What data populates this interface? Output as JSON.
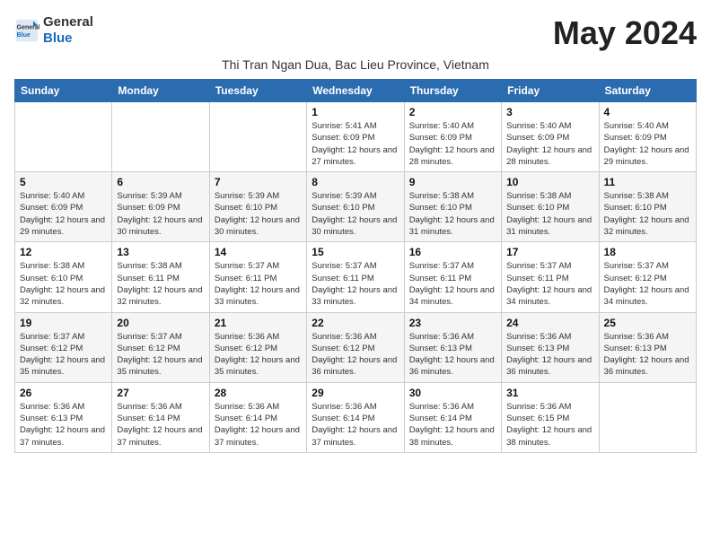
{
  "header": {
    "logo_general": "General",
    "logo_blue": "Blue",
    "month_title": "May 2024",
    "subtitle": "Thi Tran Ngan Dua, Bac Lieu Province, Vietnam"
  },
  "weekdays": [
    "Sunday",
    "Monday",
    "Tuesday",
    "Wednesday",
    "Thursday",
    "Friday",
    "Saturday"
  ],
  "weeks": [
    [
      {
        "day": "",
        "info": ""
      },
      {
        "day": "",
        "info": ""
      },
      {
        "day": "",
        "info": ""
      },
      {
        "day": "1",
        "info": "Sunrise: 5:41 AM\nSunset: 6:09 PM\nDaylight: 12 hours and 27 minutes."
      },
      {
        "day": "2",
        "info": "Sunrise: 5:40 AM\nSunset: 6:09 PM\nDaylight: 12 hours and 28 minutes."
      },
      {
        "day": "3",
        "info": "Sunrise: 5:40 AM\nSunset: 6:09 PM\nDaylight: 12 hours and 28 minutes."
      },
      {
        "day": "4",
        "info": "Sunrise: 5:40 AM\nSunset: 6:09 PM\nDaylight: 12 hours and 29 minutes."
      }
    ],
    [
      {
        "day": "5",
        "info": "Sunrise: 5:40 AM\nSunset: 6:09 PM\nDaylight: 12 hours and 29 minutes."
      },
      {
        "day": "6",
        "info": "Sunrise: 5:39 AM\nSunset: 6:09 PM\nDaylight: 12 hours and 30 minutes."
      },
      {
        "day": "7",
        "info": "Sunrise: 5:39 AM\nSunset: 6:10 PM\nDaylight: 12 hours and 30 minutes."
      },
      {
        "day": "8",
        "info": "Sunrise: 5:39 AM\nSunset: 6:10 PM\nDaylight: 12 hours and 30 minutes."
      },
      {
        "day": "9",
        "info": "Sunrise: 5:38 AM\nSunset: 6:10 PM\nDaylight: 12 hours and 31 minutes."
      },
      {
        "day": "10",
        "info": "Sunrise: 5:38 AM\nSunset: 6:10 PM\nDaylight: 12 hours and 31 minutes."
      },
      {
        "day": "11",
        "info": "Sunrise: 5:38 AM\nSunset: 6:10 PM\nDaylight: 12 hours and 32 minutes."
      }
    ],
    [
      {
        "day": "12",
        "info": "Sunrise: 5:38 AM\nSunset: 6:10 PM\nDaylight: 12 hours and 32 minutes."
      },
      {
        "day": "13",
        "info": "Sunrise: 5:38 AM\nSunset: 6:11 PM\nDaylight: 12 hours and 32 minutes."
      },
      {
        "day": "14",
        "info": "Sunrise: 5:37 AM\nSunset: 6:11 PM\nDaylight: 12 hours and 33 minutes."
      },
      {
        "day": "15",
        "info": "Sunrise: 5:37 AM\nSunset: 6:11 PM\nDaylight: 12 hours and 33 minutes."
      },
      {
        "day": "16",
        "info": "Sunrise: 5:37 AM\nSunset: 6:11 PM\nDaylight: 12 hours and 34 minutes."
      },
      {
        "day": "17",
        "info": "Sunrise: 5:37 AM\nSunset: 6:11 PM\nDaylight: 12 hours and 34 minutes."
      },
      {
        "day": "18",
        "info": "Sunrise: 5:37 AM\nSunset: 6:12 PM\nDaylight: 12 hours and 34 minutes."
      }
    ],
    [
      {
        "day": "19",
        "info": "Sunrise: 5:37 AM\nSunset: 6:12 PM\nDaylight: 12 hours and 35 minutes."
      },
      {
        "day": "20",
        "info": "Sunrise: 5:37 AM\nSunset: 6:12 PM\nDaylight: 12 hours and 35 minutes."
      },
      {
        "day": "21",
        "info": "Sunrise: 5:36 AM\nSunset: 6:12 PM\nDaylight: 12 hours and 35 minutes."
      },
      {
        "day": "22",
        "info": "Sunrise: 5:36 AM\nSunset: 6:12 PM\nDaylight: 12 hours and 36 minutes."
      },
      {
        "day": "23",
        "info": "Sunrise: 5:36 AM\nSunset: 6:13 PM\nDaylight: 12 hours and 36 minutes."
      },
      {
        "day": "24",
        "info": "Sunrise: 5:36 AM\nSunset: 6:13 PM\nDaylight: 12 hours and 36 minutes."
      },
      {
        "day": "25",
        "info": "Sunrise: 5:36 AM\nSunset: 6:13 PM\nDaylight: 12 hours and 36 minutes."
      }
    ],
    [
      {
        "day": "26",
        "info": "Sunrise: 5:36 AM\nSunset: 6:13 PM\nDaylight: 12 hours and 37 minutes."
      },
      {
        "day": "27",
        "info": "Sunrise: 5:36 AM\nSunset: 6:14 PM\nDaylight: 12 hours and 37 minutes."
      },
      {
        "day": "28",
        "info": "Sunrise: 5:36 AM\nSunset: 6:14 PM\nDaylight: 12 hours and 37 minutes."
      },
      {
        "day": "29",
        "info": "Sunrise: 5:36 AM\nSunset: 6:14 PM\nDaylight: 12 hours and 37 minutes."
      },
      {
        "day": "30",
        "info": "Sunrise: 5:36 AM\nSunset: 6:14 PM\nDaylight: 12 hours and 38 minutes."
      },
      {
        "day": "31",
        "info": "Sunrise: 5:36 AM\nSunset: 6:15 PM\nDaylight: 12 hours and 38 minutes."
      },
      {
        "day": "",
        "info": ""
      }
    ]
  ]
}
